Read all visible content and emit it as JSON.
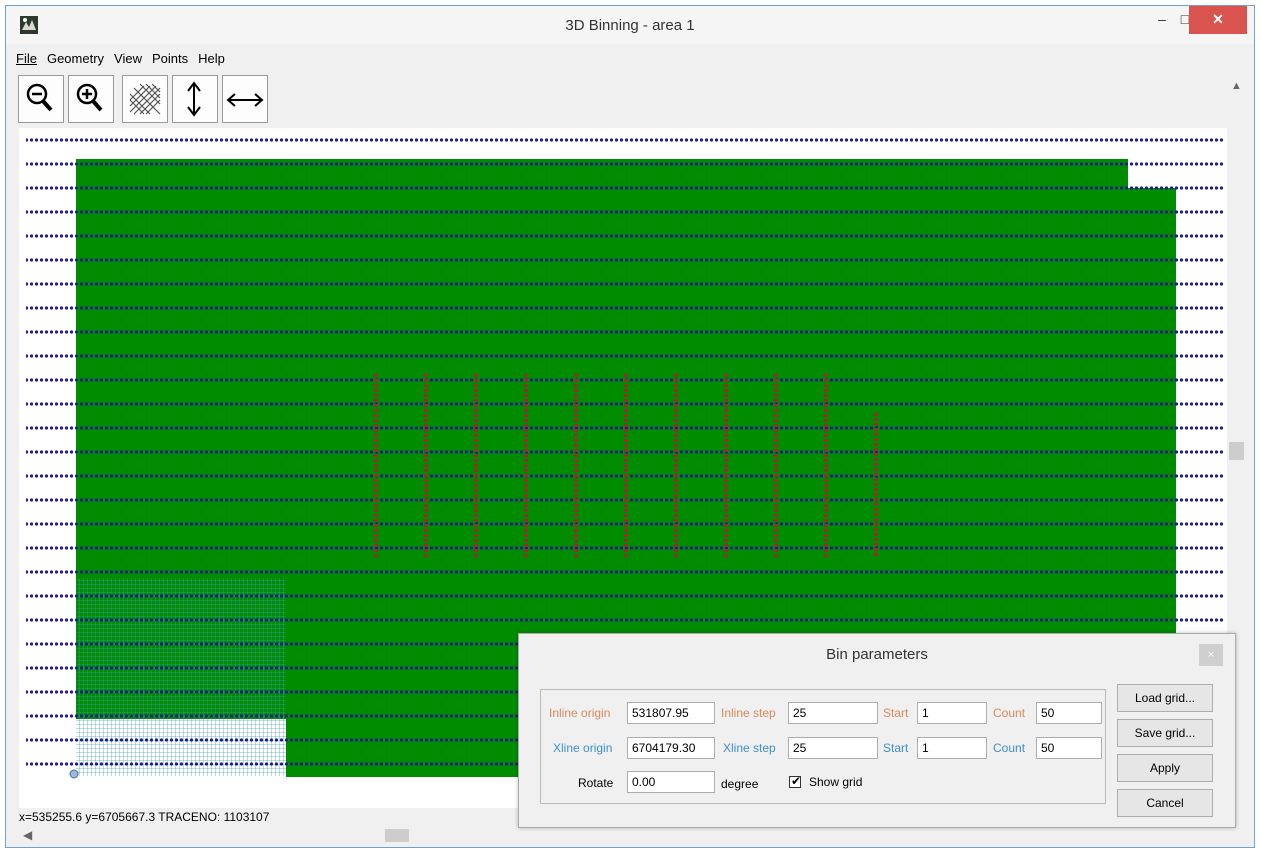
{
  "window": {
    "title": "3D Binning - area 1",
    "minimize_glyph": "–",
    "maximize_glyph": "□",
    "close_glyph": "✕"
  },
  "menu": [
    "File",
    "Geometry",
    "View",
    "Points",
    "Help"
  ],
  "toolbar": [
    {
      "icon": "zoom-out-icon"
    },
    {
      "icon": "zoom-in-icon"
    },
    {
      "icon": "grid-icon"
    },
    {
      "icon": "vertical-arrow-icon"
    },
    {
      "icon": "horizontal-arrow-icon"
    }
  ],
  "status": {
    "text": "x=535255.6 y=6705667.3 TRACENO: 1103107"
  },
  "colors": {
    "coverage": "#008c00",
    "points": "#1c1c8c",
    "highlight": "#9b2c2c",
    "grid": "#3d9ac2"
  },
  "dialog": {
    "title": "Bin parameters",
    "close_glyph": "×",
    "inline_origin_label": "Inline origin",
    "inline_origin_value": "531807.95",
    "inline_step_label": "Inline step",
    "inline_step_value": "25",
    "inline_start_label": "Start",
    "inline_start_value": "1",
    "inline_count_label": "Count",
    "inline_count_value": "50",
    "xline_origin_label": "Xline origin",
    "xline_origin_value": "6704179.30",
    "xline_step_label": "Xline step",
    "xline_step_value": "25",
    "xline_start_label": "Start",
    "xline_start_value": "1",
    "xline_count_label": "Count",
    "xline_count_value": "50",
    "rotate_label": "Rotate",
    "rotate_value": "0.00",
    "degree_label": "degree",
    "show_grid_label": "Show grid",
    "show_grid_checked": true,
    "load_grid": "Load grid...",
    "save_grid": "Save grid...",
    "apply": "Apply",
    "cancel": "Cancel"
  }
}
